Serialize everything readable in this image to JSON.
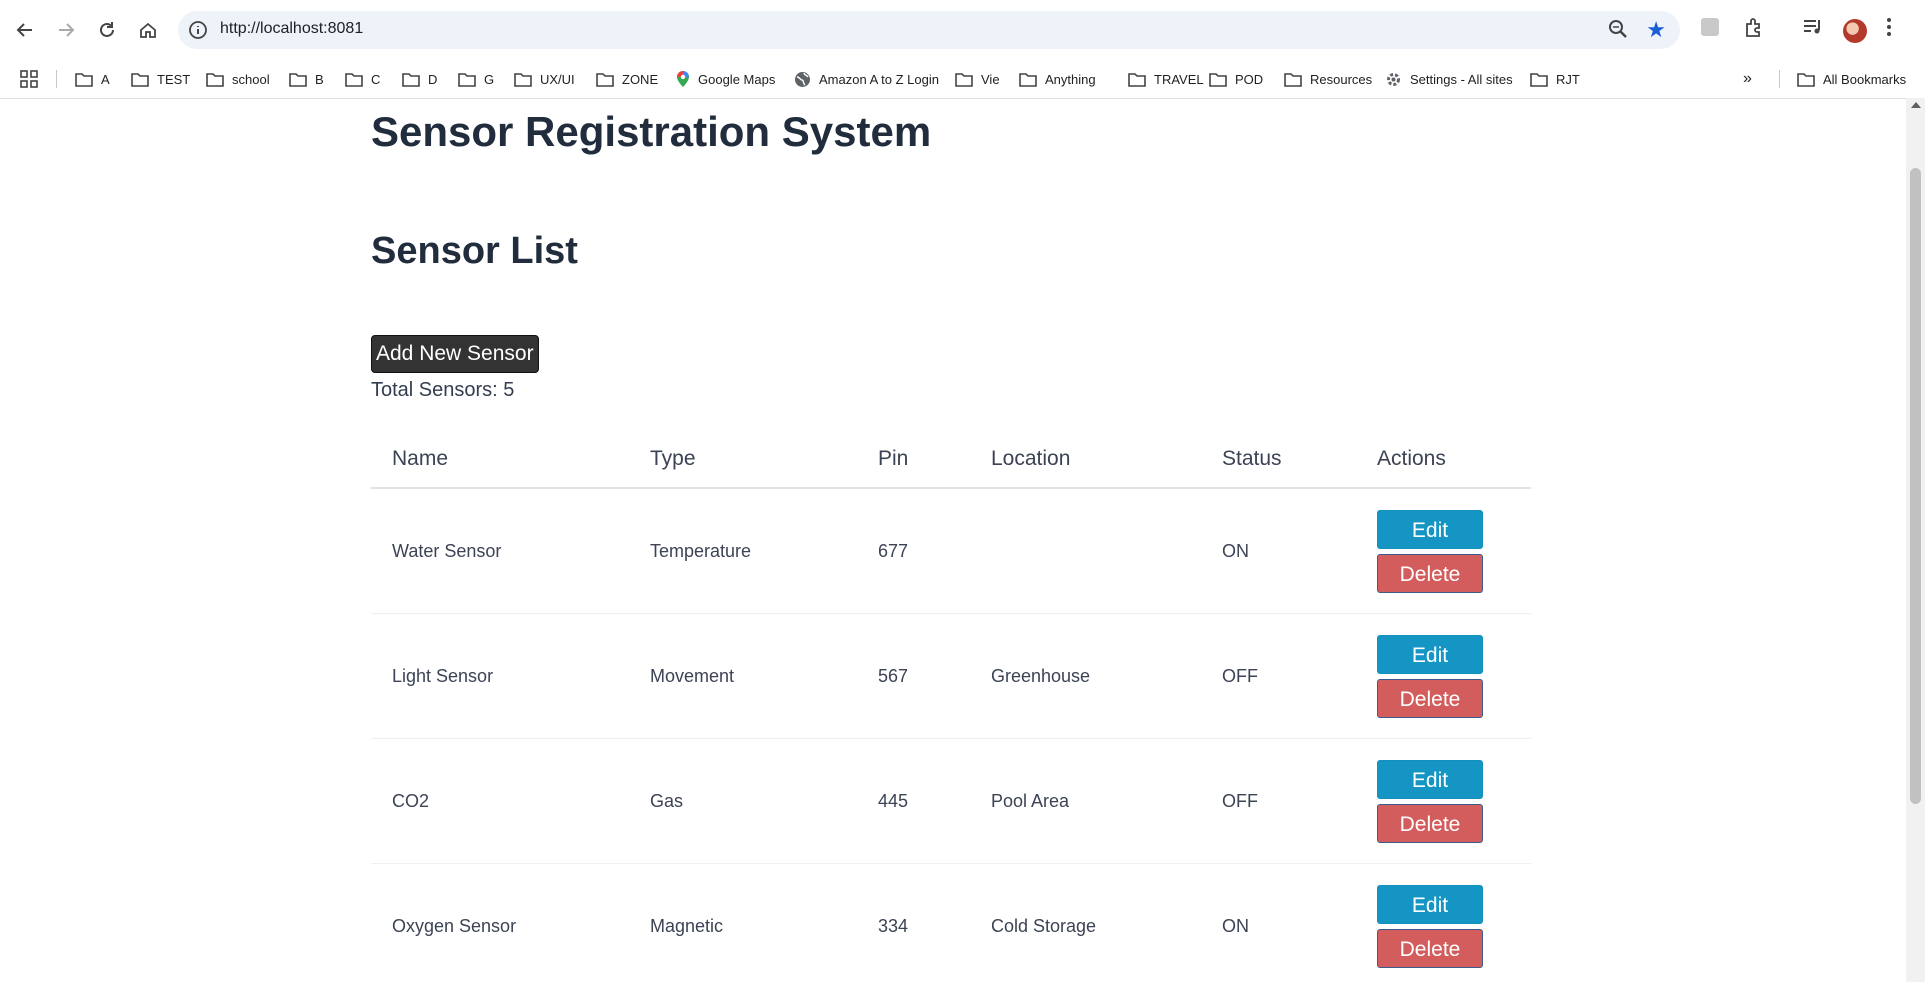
{
  "browser": {
    "url": "http://localhost:8081",
    "bookmarks": [
      {
        "label": "A",
        "icon": "folder-icon"
      },
      {
        "label": "TEST",
        "icon": "folder-icon"
      },
      {
        "label": "school",
        "icon": "folder-icon"
      },
      {
        "label": "B",
        "icon": "folder-icon"
      },
      {
        "label": "C",
        "icon": "folder-icon"
      },
      {
        "label": "D",
        "icon": "folder-icon"
      },
      {
        "label": "G",
        "icon": "folder-icon"
      },
      {
        "label": "UX/UI",
        "icon": "folder-icon"
      },
      {
        "label": "ZONE",
        "icon": "folder-icon"
      },
      {
        "label": "Google Maps",
        "icon": "maps-pin-icon"
      },
      {
        "label": "Amazon A to Z Login",
        "icon": "globe-icon"
      },
      {
        "label": "Vie",
        "icon": "folder-icon"
      },
      {
        "label": "Anything",
        "icon": "folder-icon"
      },
      {
        "label": "TRAVEL",
        "icon": "folder-icon"
      },
      {
        "label": "POD",
        "icon": "folder-icon"
      },
      {
        "label": "Resources",
        "icon": "folder-icon"
      },
      {
        "label": "Settings - All sites",
        "icon": "gear-icon"
      },
      {
        "label": "RJT",
        "icon": "folder-icon"
      }
    ],
    "all_bookmarks": "All Bookmarks",
    "overflow": "»"
  },
  "page": {
    "title": "Sensor Registration System",
    "subtitle": "Sensor List",
    "add_button": "Add New Sensor",
    "total": "Total Sensors: 5"
  },
  "table": {
    "headers": [
      "Name",
      "Type",
      "Pin",
      "Location",
      "Status",
      "Actions"
    ],
    "rows": [
      {
        "name": "Water Sensor",
        "type": "Temperature",
        "pin": "677",
        "location": "",
        "status": "ON"
      },
      {
        "name": "Light Sensor",
        "type": "Movement",
        "pin": "567",
        "location": "Greenhouse",
        "status": "OFF"
      },
      {
        "name": "CO2",
        "type": "Gas",
        "pin": "445",
        "location": "Pool Area",
        "status": "OFF"
      },
      {
        "name": "Oxygen Sensor",
        "type": "Magnetic",
        "pin": "334",
        "location": "Cold Storage",
        "status": "ON"
      }
    ],
    "edit_label": "Edit",
    "delete_label": "Delete"
  },
  "colors": {
    "edit": "#1595c4",
    "delete": "#d35c5c",
    "add": "#333333",
    "star": "#1a5fd6"
  }
}
